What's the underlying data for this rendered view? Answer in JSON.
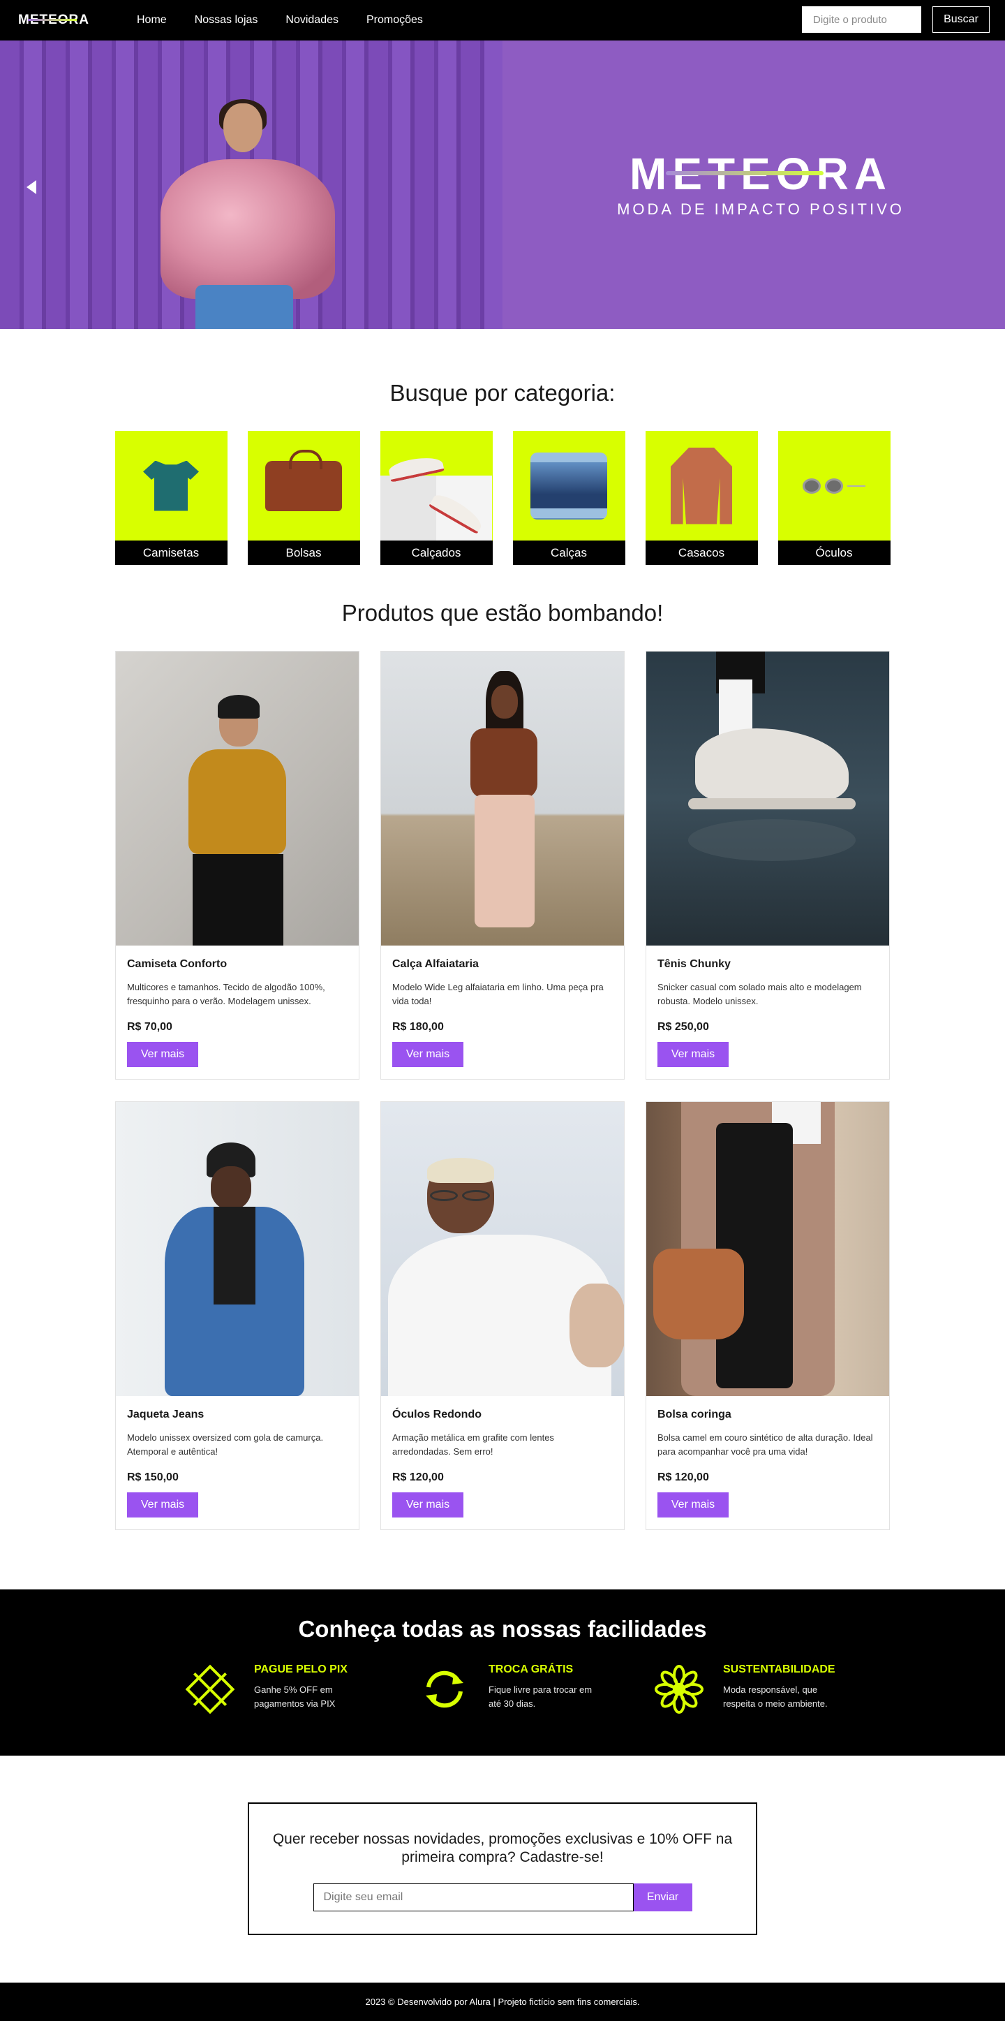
{
  "nav": {
    "logo": "METEORA",
    "links": [
      "Home",
      "Nossas lojas",
      "Novidades",
      "Promoções"
    ],
    "search_placeholder": "Digite o produto",
    "search_button": "Buscar"
  },
  "hero": {
    "brand": "METEORA",
    "tagline": "MODA DE IMPACTO POSITIVO"
  },
  "categories": {
    "title": "Busque por categoria:",
    "items": [
      {
        "label": "Camisetas",
        "icon": "tshirt-icon"
      },
      {
        "label": "Bolsas",
        "icon": "bag-icon"
      },
      {
        "label": "Calçados",
        "icon": "shoes-icon"
      },
      {
        "label": "Calças",
        "icon": "jeans-icon"
      },
      {
        "label": "Casacos",
        "icon": "coat-icon"
      },
      {
        "label": "Óculos",
        "icon": "glasses-icon"
      }
    ]
  },
  "products": {
    "title": "Produtos que estão bombando!",
    "items": [
      {
        "name": "Camiseta Conforto",
        "desc": "Multicores e tamanhos. Tecido de algodão 100%, fresquinho para o verão. Modelagem unissex.",
        "price": "R$ 70,00",
        "button": "Ver mais"
      },
      {
        "name": "Calça Alfaiataria",
        "desc": "Modelo Wide Leg alfaiataria em linho. Uma peça pra vida toda!",
        "price": "R$ 180,00",
        "button": "Ver mais"
      },
      {
        "name": "Tênis Chunky",
        "desc": "Snicker casual com solado mais alto e modelagem robusta. Modelo unissex.",
        "price": "R$ 250,00",
        "button": "Ver mais"
      },
      {
        "name": "Jaqueta Jeans",
        "desc": "Modelo unissex oversized com gola de camurça. Atemporal e autêntica!",
        "price": "R$ 150,00",
        "button": "Ver mais"
      },
      {
        "name": "Óculos Redondo",
        "desc": "Armação metálica em grafite com lentes arredondadas. Sem erro!",
        "price": "R$ 120,00",
        "button": "Ver mais"
      },
      {
        "name": "Bolsa coringa",
        "desc": "Bolsa camel em couro sintético de alta duração. Ideal para acompanhar você pra uma vida!",
        "price": "R$ 120,00",
        "button": "Ver mais"
      }
    ]
  },
  "features": {
    "title": "Conheça todas as nossas facilidades",
    "items": [
      {
        "title": "PAGUE PELO PIX",
        "text": "Ganhe 5% OFF em pagamentos via PIX",
        "icon": "pix-icon"
      },
      {
        "title": "TROCA GRÁTIS",
        "text": "Fique livre para trocar em até 30 dias.",
        "icon": "exchange-icon"
      },
      {
        "title": "SUSTENTABILIDADE",
        "text": "Moda responsável, que respeita o meio ambiente.",
        "icon": "flower-icon"
      }
    ]
  },
  "newsletter": {
    "text": "Quer receber nossas novidades, promoções exclusivas e 10% OFF na primeira compra? Cadastre-se!",
    "placeholder": "Digite seu email",
    "button": "Enviar"
  },
  "footer": {
    "text": "2023 © Desenvolvido por Alura | Projeto fictício sem fins comerciais."
  },
  "colors": {
    "accent": "#9a53f0",
    "lime": "#d8ff00",
    "hero_purple": "#8e5cc2"
  }
}
